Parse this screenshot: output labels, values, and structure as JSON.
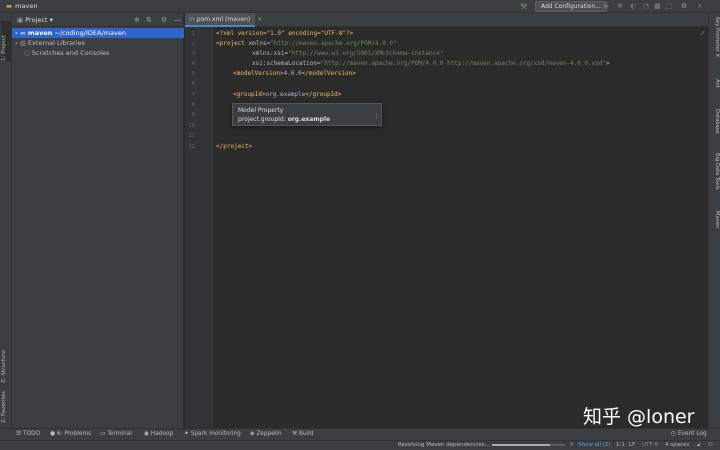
{
  "window": {
    "title": "maven"
  },
  "toolbar": {
    "add_config_label": "Add Configuration..."
  },
  "left_strip": {
    "project_tab": "1: Project",
    "structure_tab": "Z: Structure",
    "favorites_tab": "2: Favorites"
  },
  "project_panel": {
    "title": "Project",
    "tree": [
      {
        "name": "maven",
        "path": "~/coding/IDEA/maven"
      },
      {
        "name": "External Libraries"
      },
      {
        "name": "Scratches and Consoles"
      }
    ]
  },
  "editor": {
    "tab_label": "pom.xml (maven)",
    "line_numbers": [
      "1",
      "2",
      "3",
      "4",
      "5",
      "6",
      "7",
      "8",
      "9",
      "10",
      "11",
      "12"
    ],
    "code": {
      "l1_pi": "<?xml version=\"1.0\" encoding=\"UTF-8\"?>",
      "l2_open": "<project",
      "l2_attr": " xmlns",
      "l2_eq": "=",
      "l2_val": "\"http://maven.apache.org/POM/4.0.0\"",
      "l3_attr": "xmlns:xsi",
      "l3_eq": "=",
      "l3_val": "\"http://www.w3.org/2001/XMLSchema-instance\"",
      "l4_attr": "xsi:schemaLocation",
      "l4_eq": "=",
      "l4_val": "\"http://maven.apache.org/POM/4.0.0 http://maven.apache.org/xsd/maven-4.0.0.xsd\"",
      "l4_close": ">",
      "l5_open": "<modelVersion>",
      "l5_text": "4.0.0",
      "l5_close": "</modelVersion>",
      "l7_open": "<groupId>",
      "l7_text": "org.example",
      "l7_close": "</groupId>",
      "l12_close": "</project>"
    }
  },
  "popup": {
    "title": "Model Property",
    "prop_key": "project.groupId:",
    "prop_value": "org.example"
  },
  "right_strip": {
    "tabs": [
      "Key Promoter X",
      "Ant",
      "Database",
      "Big Data Tools",
      "Maven"
    ]
  },
  "bottom_tabs": [
    "TODO",
    "6: Problems",
    "Terminal",
    "Hadoop",
    "Spark monitoring",
    "Zeppelin",
    "Build"
  ],
  "event_log": "Event Log",
  "status": {
    "message": "Resolving Maven dependencies...",
    "show_all": "Show all (2)",
    "position": "1:1",
    "line_sep": "LF",
    "encoding": "UTF-8",
    "indent": "4 spaces",
    "progress": 0.8
  },
  "watermark": "知乎 @loner",
  "colors": {
    "selection": "#2f65ca",
    "tag": "#e8bf6a",
    "string": "#6a8759",
    "accent_green": "#58a05a"
  }
}
